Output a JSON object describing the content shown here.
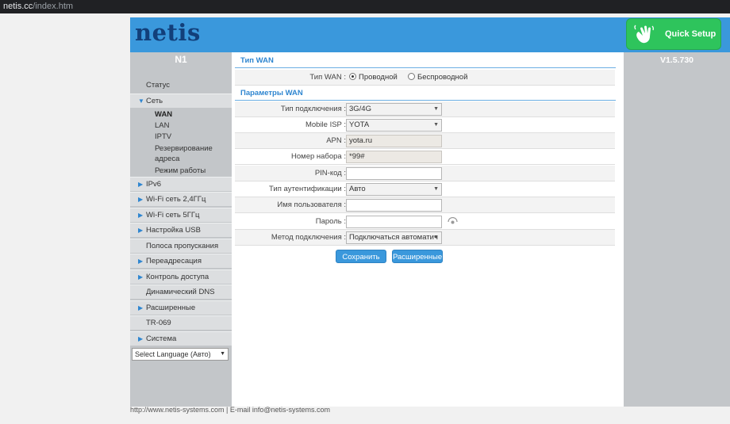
{
  "browser": {
    "url_host": "netis.cc",
    "url_path": "/index.htm"
  },
  "header": {
    "logo": "netis",
    "quick_setup": "Quick Setup"
  },
  "sidebar": {
    "model": "N1",
    "items": [
      {
        "label": "Статус"
      },
      {
        "label": "Сеть"
      },
      {
        "label": "IPv6"
      },
      {
        "label": "Wi-Fi сеть 2,4ГГц"
      },
      {
        "label": "Wi-Fi сеть 5ГГц"
      },
      {
        "label": "Настройка USB"
      },
      {
        "label": "Полоса пропускания"
      },
      {
        "label": "Переадресация"
      },
      {
        "label": "Контроль доступа"
      },
      {
        "label": "Динамический DNS"
      },
      {
        "label": "Расширенные"
      },
      {
        "label": "TR-069"
      },
      {
        "label": "Система"
      }
    ],
    "sub_items": [
      {
        "label": "WAN"
      },
      {
        "label": "LAN"
      },
      {
        "label": "IPTV"
      },
      {
        "label": "Резервирование"
      },
      {
        "label": "адреса"
      },
      {
        "label": "Режим работы"
      }
    ],
    "language": "Select Language (Авто)"
  },
  "version": "V1.5.730",
  "wan_type": {
    "title": "Тип WAN",
    "label": "Тип WAN :",
    "options": [
      "Проводной",
      "Беспроводной"
    ],
    "selected": "Проводной"
  },
  "wan_params": {
    "title": "Параметры WAN",
    "rows": [
      {
        "label": "Тип подключения :",
        "value": "3G/4G"
      },
      {
        "label": "Mobile ISP :",
        "value": "YOTA"
      },
      {
        "label": "APN :",
        "value": "yota.ru"
      },
      {
        "label": "Номер набора :",
        "value": "*99#"
      },
      {
        "label": "PIN-код :",
        "value": ""
      },
      {
        "label": "Тип аутентификации :",
        "value": "Авто"
      },
      {
        "label": "Имя пользователя :",
        "value": ""
      },
      {
        "label": "Пароль :",
        "value": ""
      },
      {
        "label": "Метод подключения :",
        "value": "Подключаться автоматич"
      }
    ]
  },
  "buttons": {
    "save": "Сохранить",
    "advanced": "Расширенные"
  },
  "footer": "http://www.netis-systems.com | E-mail info@netis-systems.com",
  "colors": {
    "header_blue": "#3a98dc",
    "quick_setup_green": "#2ec45c",
    "sidebar_gray": "#c3c6c9",
    "accent_blue": "#2f86d0"
  }
}
